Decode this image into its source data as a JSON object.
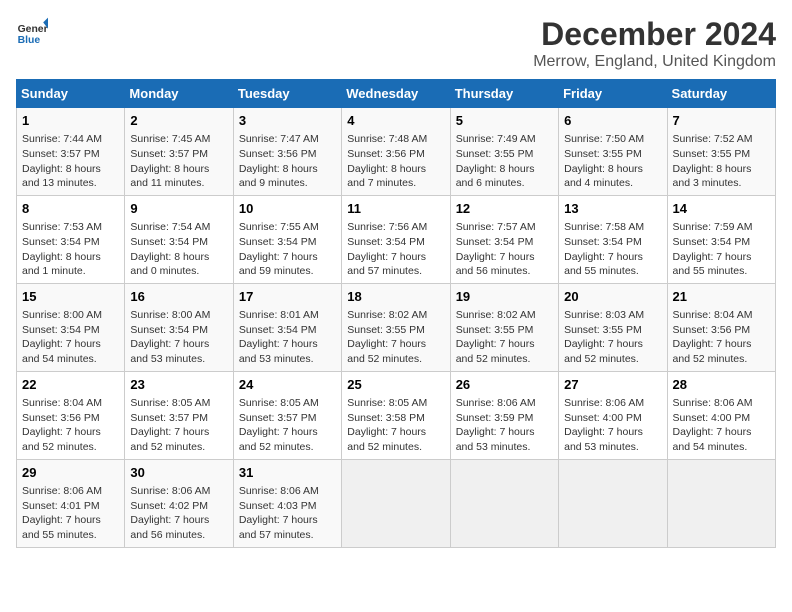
{
  "header": {
    "logo_line1": "General",
    "logo_line2": "Blue",
    "title": "December 2024",
    "subtitle": "Merrow, England, United Kingdom"
  },
  "columns": [
    "Sunday",
    "Monday",
    "Tuesday",
    "Wednesday",
    "Thursday",
    "Friday",
    "Saturday"
  ],
  "weeks": [
    [
      {
        "day": "1",
        "info": "Sunrise: 7:44 AM\nSunset: 3:57 PM\nDaylight: 8 hours\nand 13 minutes."
      },
      {
        "day": "2",
        "info": "Sunrise: 7:45 AM\nSunset: 3:57 PM\nDaylight: 8 hours\nand 11 minutes."
      },
      {
        "day": "3",
        "info": "Sunrise: 7:47 AM\nSunset: 3:56 PM\nDaylight: 8 hours\nand 9 minutes."
      },
      {
        "day": "4",
        "info": "Sunrise: 7:48 AM\nSunset: 3:56 PM\nDaylight: 8 hours\nand 7 minutes."
      },
      {
        "day": "5",
        "info": "Sunrise: 7:49 AM\nSunset: 3:55 PM\nDaylight: 8 hours\nand 6 minutes."
      },
      {
        "day": "6",
        "info": "Sunrise: 7:50 AM\nSunset: 3:55 PM\nDaylight: 8 hours\nand 4 minutes."
      },
      {
        "day": "7",
        "info": "Sunrise: 7:52 AM\nSunset: 3:55 PM\nDaylight: 8 hours\nand 3 minutes."
      }
    ],
    [
      {
        "day": "8",
        "info": "Sunrise: 7:53 AM\nSunset: 3:54 PM\nDaylight: 8 hours\nand 1 minute."
      },
      {
        "day": "9",
        "info": "Sunrise: 7:54 AM\nSunset: 3:54 PM\nDaylight: 8 hours\nand 0 minutes."
      },
      {
        "day": "10",
        "info": "Sunrise: 7:55 AM\nSunset: 3:54 PM\nDaylight: 7 hours\nand 59 minutes."
      },
      {
        "day": "11",
        "info": "Sunrise: 7:56 AM\nSunset: 3:54 PM\nDaylight: 7 hours\nand 57 minutes."
      },
      {
        "day": "12",
        "info": "Sunrise: 7:57 AM\nSunset: 3:54 PM\nDaylight: 7 hours\nand 56 minutes."
      },
      {
        "day": "13",
        "info": "Sunrise: 7:58 AM\nSunset: 3:54 PM\nDaylight: 7 hours\nand 55 minutes."
      },
      {
        "day": "14",
        "info": "Sunrise: 7:59 AM\nSunset: 3:54 PM\nDaylight: 7 hours\nand 55 minutes."
      }
    ],
    [
      {
        "day": "15",
        "info": "Sunrise: 8:00 AM\nSunset: 3:54 PM\nDaylight: 7 hours\nand 54 minutes."
      },
      {
        "day": "16",
        "info": "Sunrise: 8:00 AM\nSunset: 3:54 PM\nDaylight: 7 hours\nand 53 minutes."
      },
      {
        "day": "17",
        "info": "Sunrise: 8:01 AM\nSunset: 3:54 PM\nDaylight: 7 hours\nand 53 minutes."
      },
      {
        "day": "18",
        "info": "Sunrise: 8:02 AM\nSunset: 3:55 PM\nDaylight: 7 hours\nand 52 minutes."
      },
      {
        "day": "19",
        "info": "Sunrise: 8:02 AM\nSunset: 3:55 PM\nDaylight: 7 hours\nand 52 minutes."
      },
      {
        "day": "20",
        "info": "Sunrise: 8:03 AM\nSunset: 3:55 PM\nDaylight: 7 hours\nand 52 minutes."
      },
      {
        "day": "21",
        "info": "Sunrise: 8:04 AM\nSunset: 3:56 PM\nDaylight: 7 hours\nand 52 minutes."
      }
    ],
    [
      {
        "day": "22",
        "info": "Sunrise: 8:04 AM\nSunset: 3:56 PM\nDaylight: 7 hours\nand 52 minutes."
      },
      {
        "day": "23",
        "info": "Sunrise: 8:05 AM\nSunset: 3:57 PM\nDaylight: 7 hours\nand 52 minutes."
      },
      {
        "day": "24",
        "info": "Sunrise: 8:05 AM\nSunset: 3:57 PM\nDaylight: 7 hours\nand 52 minutes."
      },
      {
        "day": "25",
        "info": "Sunrise: 8:05 AM\nSunset: 3:58 PM\nDaylight: 7 hours\nand 52 minutes."
      },
      {
        "day": "26",
        "info": "Sunrise: 8:06 AM\nSunset: 3:59 PM\nDaylight: 7 hours\nand 53 minutes."
      },
      {
        "day": "27",
        "info": "Sunrise: 8:06 AM\nSunset: 4:00 PM\nDaylight: 7 hours\nand 53 minutes."
      },
      {
        "day": "28",
        "info": "Sunrise: 8:06 AM\nSunset: 4:00 PM\nDaylight: 7 hours\nand 54 minutes."
      }
    ],
    [
      {
        "day": "29",
        "info": "Sunrise: 8:06 AM\nSunset: 4:01 PM\nDaylight: 7 hours\nand 55 minutes."
      },
      {
        "day": "30",
        "info": "Sunrise: 8:06 AM\nSunset: 4:02 PM\nDaylight: 7 hours\nand 56 minutes."
      },
      {
        "day": "31",
        "info": "Sunrise: 8:06 AM\nSunset: 4:03 PM\nDaylight: 7 hours\nand 57 minutes."
      },
      {
        "day": "",
        "info": ""
      },
      {
        "day": "",
        "info": ""
      },
      {
        "day": "",
        "info": ""
      },
      {
        "day": "",
        "info": ""
      }
    ]
  ]
}
